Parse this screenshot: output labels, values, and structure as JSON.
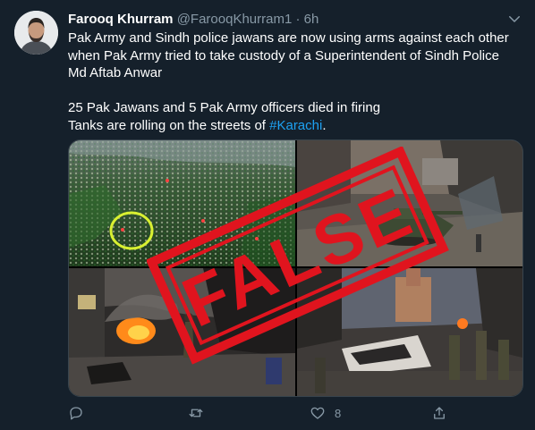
{
  "tweet": {
    "author_name": "Farooq Khurram",
    "handle": "@FarooqKhurram1",
    "separator": "·",
    "time": "6h",
    "text_line1": "Pak Army and Sindh police jawans are now using arms against each other when Pak Army tried to take custody of a Superintendent of Sindh Police Md Aftab Anwar",
    "text_line2": "25 Pak Jawans and 5 Pak Army officers died in firing",
    "text_line3_prefix": "Tanks are rolling on the streets of ",
    "hashtag": "#Karachi",
    "text_line3_suffix": ".",
    "stamp_text": "FALSE",
    "like_count": "8"
  },
  "icons": {
    "menu": "chevron-down-icon",
    "reply": "reply-icon",
    "retweet": "retweet-icon",
    "like": "heart-icon",
    "share": "share-icon"
  },
  "colors": {
    "background": "#15202b",
    "text_primary": "#ffffff",
    "text_secondary": "#8899a6",
    "link": "#1da1f2",
    "stamp_red": "#e0141e"
  }
}
